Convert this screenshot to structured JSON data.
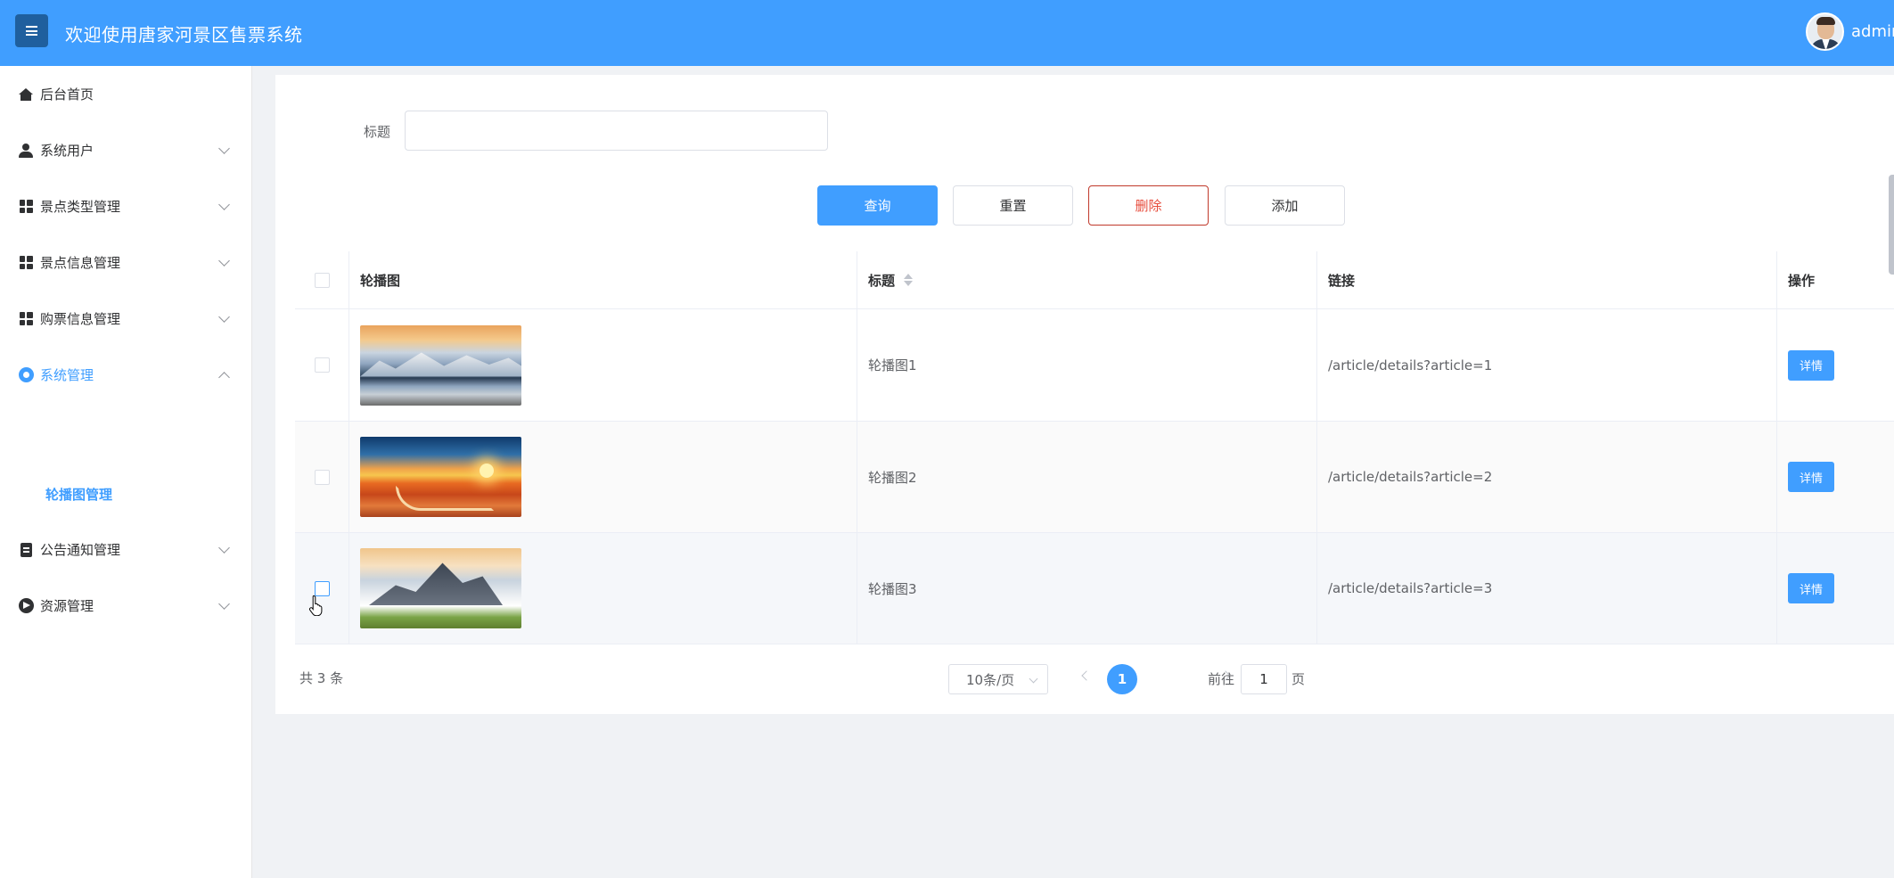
{
  "header": {
    "title": "欢迎使用唐家河景区售票系统",
    "username": "admin",
    "accent_color": "#409eff"
  },
  "sidebar": {
    "items": [
      {
        "label": "后台首页",
        "icon": "home-icon",
        "expandable": false
      },
      {
        "label": "系统用户",
        "icon": "user-icon",
        "expandable": true
      },
      {
        "label": "景点类型管理",
        "icon": "grid-icon",
        "expandable": true
      },
      {
        "label": "景点信息管理",
        "icon": "grid-icon",
        "expandable": true
      },
      {
        "label": "购票信息管理",
        "icon": "grid-icon",
        "expandable": true
      },
      {
        "label": "系统管理",
        "icon": "gear-icon",
        "expandable": true,
        "expanded": true,
        "active": true
      },
      {
        "label": "公告通知管理",
        "icon": "document-icon",
        "expandable": true
      },
      {
        "label": "资源管理",
        "icon": "resource-icon",
        "expandable": true
      }
    ],
    "active_sub_item": "轮播图管理"
  },
  "search": {
    "label": "标题",
    "value": "",
    "placeholder": ""
  },
  "toolbar": {
    "query_label": "查询",
    "reset_label": "重置",
    "delete_label": "删除",
    "add_label": "添加"
  },
  "table": {
    "columns": [
      "轮播图",
      "标题",
      "链接",
      "操作"
    ],
    "rows": [
      {
        "image": "mountain-lake-image",
        "title": "轮播图1",
        "link": "/article/details?article=1",
        "action": "详情"
      },
      {
        "image": "sunset-river-image",
        "title": "轮播图2",
        "link": "/article/details?article=2",
        "action": "详情"
      },
      {
        "image": "sea-of-clouds-image",
        "title": "轮播图3",
        "link": "/article/details?article=3",
        "action": "详情"
      }
    ]
  },
  "pagination": {
    "total_text": "共 3 条",
    "page_size": "10条/页",
    "current_page": "1",
    "goto_prefix": "前往",
    "goto_value": "1",
    "goto_suffix": "页"
  }
}
